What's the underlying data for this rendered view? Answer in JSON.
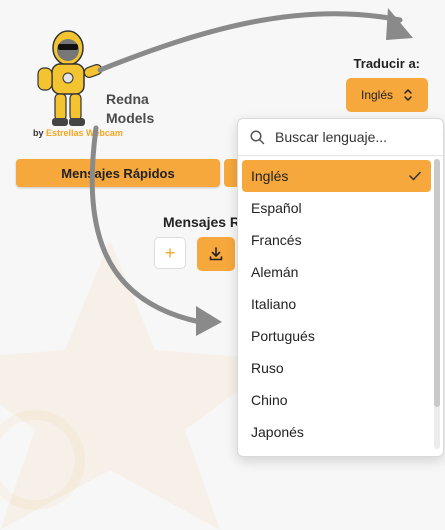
{
  "brand": {
    "line1": "Redna",
    "line2": "Models",
    "by": "by",
    "company": "Estrellas Webcam"
  },
  "tabs": {
    "quick_messages": "Mensajes Rápidos"
  },
  "section": {
    "title": "Mensajes R"
  },
  "actions": {
    "add_symbol": "+"
  },
  "translate": {
    "label": "Traducir a:",
    "selected": "Inglés"
  },
  "dropdown": {
    "search_placeholder": "Buscar lenguaje...",
    "options": [
      "Inglés",
      "Español",
      "Francés",
      "Alemán",
      "Italiano",
      "Portugués",
      "Ruso",
      "Chino",
      "Japonés"
    ],
    "selected_index": 0
  },
  "icons": {
    "search": "search-icon",
    "check": "check-icon",
    "updown": "chevron-updown-icon",
    "download": "download-icon"
  },
  "colors": {
    "accent": "#f7a83c",
    "background": "#f7f7f7",
    "arrow": "#8a8a8a"
  }
}
